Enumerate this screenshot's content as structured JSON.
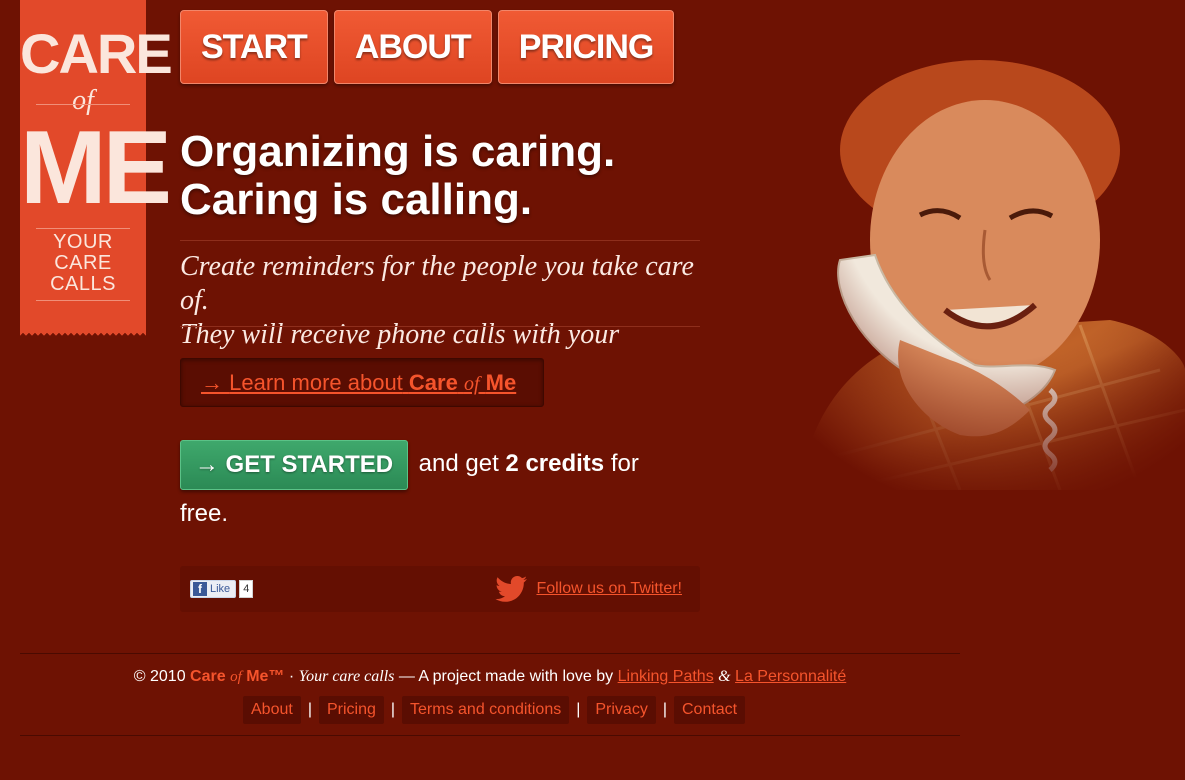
{
  "logo": {
    "care": "CARE",
    "of": "of",
    "me": "ME",
    "tagline_1": "YOUR",
    "tagline_2": "CARE",
    "tagline_3": "CALLS"
  },
  "nav": {
    "items": [
      {
        "label": "START"
      },
      {
        "label": "ABOUT"
      },
      {
        "label": "PRICING"
      }
    ]
  },
  "hero": {
    "headline_1": "Organizing is caring.",
    "headline_2": "Caring is calling.",
    "subline_1": "Create reminders for the people you take care of.",
    "subline_2": "They will receive phone calls with your message."
  },
  "learn_more": {
    "arrow": "→",
    "prefix": "Learn more about",
    "brand_care": "Care",
    "brand_of": "of",
    "brand_me": "Me"
  },
  "cta": {
    "button_label": "→ GET STARTED",
    "text_before": "and get",
    "credits": "2 credits",
    "text_after": "for free."
  },
  "social": {
    "fb_icon": "f",
    "fb_like": "Like",
    "fb_count": "4",
    "twitter_icon": "twitter-bird-icon",
    "twitter_label": "Follow us on Twitter!"
  },
  "photo": {
    "icon": "elderly-woman-on-phone-photo"
  },
  "footer": {
    "copyright": "© 2010",
    "brand_care": "Care",
    "brand_of": "of",
    "brand_me": "Me™",
    "dot": "·",
    "tagline": "Your care calls",
    "made_by": "— A project made with love by",
    "partner_1": "Linking Paths",
    "amp": "&",
    "partner_2": "La Personnalité",
    "links": [
      {
        "label": "About"
      },
      {
        "label": "Pricing"
      },
      {
        "label": "Terms and conditions"
      },
      {
        "label": "Privacy"
      },
      {
        "label": "Contact"
      }
    ],
    "separator": "|"
  },
  "colors": {
    "background": "#6e1203",
    "accent": "#e2492a",
    "link": "#f5542c",
    "cta_green": "#2b8a55"
  }
}
